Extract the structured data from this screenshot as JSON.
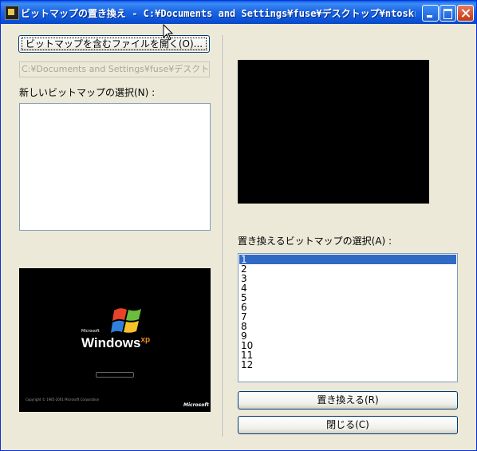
{
  "window": {
    "title": "ビットマップの置き換え - C:¥Documents and Settings¥fuse¥デスクトップ¥ntoskr..."
  },
  "left": {
    "open_button_label": "ビットマップを含むファイルを開く(O)...",
    "path_value": "C:¥Documents and Settings¥fuse¥デスクトップ",
    "new_bitmap_label": "新しいビットマップの選択(N) :",
    "xp_boot": {
      "brand_small": "Microsoft",
      "brand": "Windows",
      "edition": "xp",
      "copyright": "Copyright © 1985-2001 Microsoft Corporation",
      "maker": "Microsoft"
    }
  },
  "right": {
    "replace_list_label": "置き換えるビットマップの選択(A) :",
    "bitmap_items": [
      "1",
      "2",
      "3",
      "4",
      "5",
      "6",
      "7",
      "8",
      "9",
      "10",
      "11",
      "12"
    ],
    "selected_item": "1",
    "replace_button_label": "置き換える(R)",
    "close_button_label": "閉じる(C)"
  },
  "colors": {
    "titlebar": "#0a55d9",
    "dialog_bg": "#ece9d8",
    "selection": "#316ac5"
  },
  "icons": [
    "app-icon",
    "minimize-icon",
    "maximize-icon",
    "close-icon",
    "windows-flag-icon",
    "mouse-cursor-icon"
  ]
}
